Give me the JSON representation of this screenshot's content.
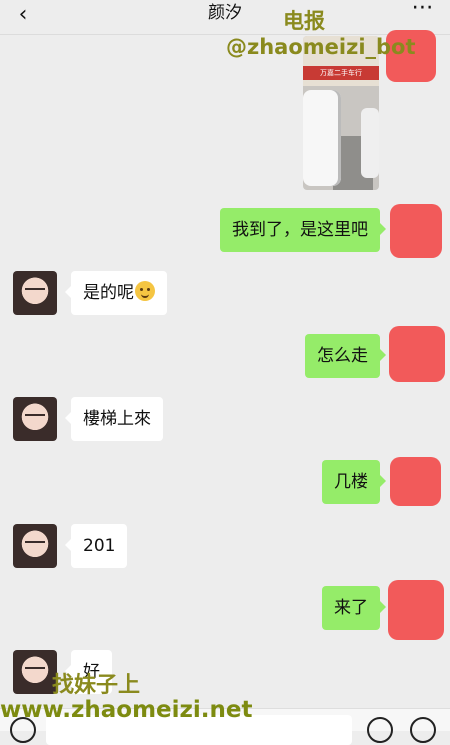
{
  "header": {
    "title": "颜汐",
    "back_icon": "chevron-left-icon",
    "more_icon": "more-dots-icon"
  },
  "watermarks": {
    "top_line1": "电报",
    "top_line2": "@zhaomeizi_bot",
    "bottom_line1": "找妹子上",
    "bottom_line2": "www.zhaomeizi.net"
  },
  "messages": [
    {
      "side": "right",
      "type": "image",
      "text": ""
    },
    {
      "side": "right",
      "type": "text",
      "text": "我到了，是这里吧"
    },
    {
      "side": "left",
      "type": "text",
      "text": "是的呢"
    },
    {
      "side": "right",
      "type": "text",
      "text": "怎么走"
    },
    {
      "side": "left",
      "type": "text",
      "text": "樓梯上來"
    },
    {
      "side": "right",
      "type": "text",
      "text": "几楼"
    },
    {
      "side": "left",
      "type": "text",
      "text": "201"
    },
    {
      "side": "right",
      "type": "text",
      "text": "来了"
    },
    {
      "side": "left",
      "type": "text",
      "text": "好"
    }
  ],
  "photo": {
    "sign_text": "万嘉二手车行"
  },
  "colors": {
    "background": "#ededed",
    "self_bubble": "#95ec69",
    "other_bubble": "#ffffff",
    "redaction": "#f25a5a",
    "watermark": "#8a8a1e"
  }
}
